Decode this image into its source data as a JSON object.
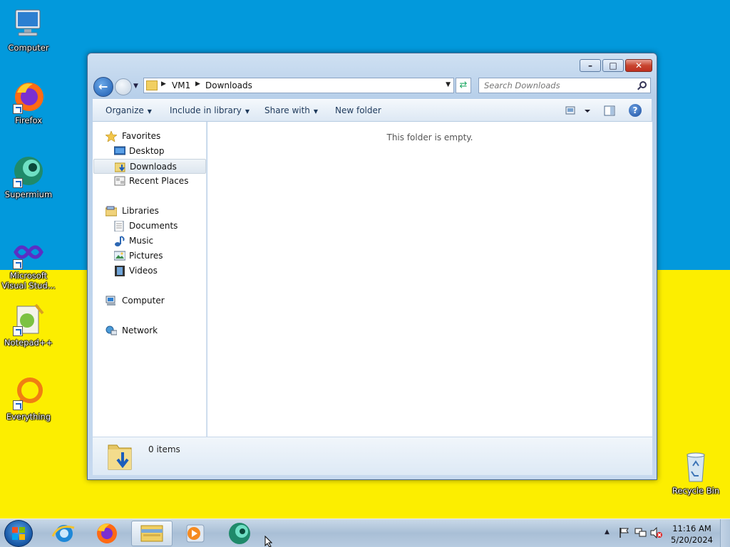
{
  "desktop": {
    "colors": {
      "top": "#0299dc",
      "bottom": "#fcee00"
    },
    "icons": [
      {
        "label": "Computer",
        "icon": "computer-icon"
      },
      {
        "label": "Firefox",
        "icon": "firefox-icon"
      },
      {
        "label": "Supermium",
        "icon": "supermium-icon"
      },
      {
        "label": "Microsoft Visual Stud...",
        "icon": "visual-studio-icon"
      },
      {
        "label": "Notepad++",
        "icon": "notepad-plus-plus-icon"
      },
      {
        "label": "Everything",
        "icon": "everything-icon"
      },
      {
        "label": "Recycle Bin",
        "icon": "recycle-bin-icon"
      }
    ]
  },
  "window": {
    "address": {
      "crumbs": [
        "VM1",
        "Downloads"
      ]
    },
    "search": {
      "placeholder": "Search Downloads"
    },
    "toolbar": {
      "organize": "Organize",
      "include_in_library": "Include in library",
      "share_with": "Share with",
      "new_folder": "New folder"
    },
    "nav": {
      "favorites": "Favorites",
      "desktop": "Desktop",
      "downloads": "Downloads",
      "recent_places": "Recent Places",
      "libraries": "Libraries",
      "documents": "Documents",
      "music": "Music",
      "pictures": "Pictures",
      "videos": "Videos",
      "computer": "Computer",
      "network": "Network",
      "selected": "Downloads"
    },
    "content": {
      "empty_message": "This folder is empty."
    },
    "details": {
      "item_count": "0 items"
    }
  },
  "taskbar": {
    "pinned": [
      "start-orb",
      "internet-explorer-icon",
      "firefox-icon",
      "explorer-icon",
      "media-player-icon",
      "supermium-icon"
    ],
    "active": "explorer-icon",
    "tray": {
      "time": "11:16 AM",
      "date": "5/20/2024"
    }
  }
}
